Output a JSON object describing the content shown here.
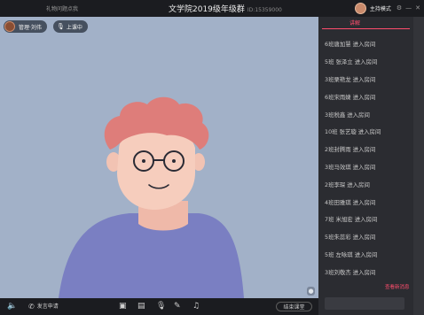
{
  "top": {
    "left_link": "礼物问题点我",
    "title": "文学院2019级年级群",
    "room_id": "ID:15359000",
    "mode": "主持模式"
  },
  "stage": {
    "user_chip": "管理·刘伟",
    "class_chip": "上课中"
  },
  "bottom": {
    "apply": "发言申请",
    "end_class": "结束课堂"
  },
  "panel": {
    "tab": "讲解",
    "more": "查看新消息",
    "messages": [
      "6班唐加慧 进入房间",
      "5班 张泽立 进入房间",
      "3班栗艳龙 进入房间",
      "6班宋雨婕 进入房间",
      "3班税鑫 进入房间",
      "10班 张艺璇 进入房间",
      "2班封腾雨 进入房间",
      "3班马效琪 进入房间",
      "2班李琛 进入房间",
      "4班田雅琪 进入房间",
      "7班 米旭宏 进入房间",
      "5班朱蕊彩 进入房间",
      "5班 左咏琪 进入房间",
      "3班刘敬杰 进入房间"
    ]
  },
  "icons": {
    "volume": "volume-icon",
    "phone": "phone-icon",
    "camera": "camera-icon",
    "screen_share": "screen-share-icon",
    "microphone": "microphone-icon",
    "edit": "edit-icon",
    "music": "music-icon"
  },
  "colors": {
    "accent": "#ff4d6d",
    "stage_bg": "#a2b1c8"
  }
}
